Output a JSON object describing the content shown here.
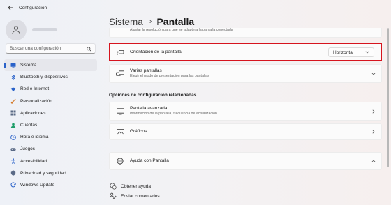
{
  "window": {
    "title": "Configuración"
  },
  "sidebar": {
    "search_placeholder": "Buscar una configuración",
    "items": [
      {
        "label": "Sistema",
        "icon": "monitor-icon",
        "color": "#2a62c9",
        "active": true
      },
      {
        "label": "Bluetooth y dispositivos",
        "icon": "bluetooth-icon",
        "color": "#2a62c9"
      },
      {
        "label": "Red e Internet",
        "icon": "wifi-icon",
        "color": "#2a62c9"
      },
      {
        "label": "Personalización",
        "icon": "brush-icon",
        "color": "#d47b2b"
      },
      {
        "label": "Aplicaciones",
        "icon": "apps-icon",
        "color": "#5a6a86"
      },
      {
        "label": "Cuentas",
        "icon": "person-icon",
        "color": "#1f9e6a"
      },
      {
        "label": "Hora e idioma",
        "icon": "globe-clock-icon",
        "color": "#2a62c9"
      },
      {
        "label": "Juegos",
        "icon": "gamepad-icon",
        "color": "#5a6a86"
      },
      {
        "label": "Accesibilidad",
        "icon": "accessibility-icon",
        "color": "#2a62c9"
      },
      {
        "label": "Privacidad y seguridad",
        "icon": "shield-icon",
        "color": "#5a6a86"
      },
      {
        "label": "Windows Update",
        "icon": "refresh-icon",
        "color": "#2a62c9"
      }
    ]
  },
  "header": {
    "parent": "Sistema",
    "current": "Pantalla"
  },
  "settings": {
    "resolution_sub": "Ajustar la resolución para que se adapte a la pantalla conectada",
    "orientation": {
      "title": "Orientación de la pantalla",
      "value": "Horizontal"
    },
    "multi": {
      "title": "Varias pantallas",
      "sub": "Elegir el modo de presentación para las pantallas"
    }
  },
  "related": {
    "heading": "Opciones de configuración relacionadas",
    "advanced": {
      "title": "Pantalla avanzada",
      "sub": "Información de la pantalla, frecuencia de actualización"
    },
    "graphics": {
      "title": "Gráficos"
    }
  },
  "help": {
    "title": "Ayuda con Pantalla"
  },
  "links": {
    "get_help": "Obtener ayuda",
    "feedback": "Enviar comentarios"
  },
  "colors": {
    "accent": "#2a62c9",
    "highlight": "#d6141e"
  }
}
